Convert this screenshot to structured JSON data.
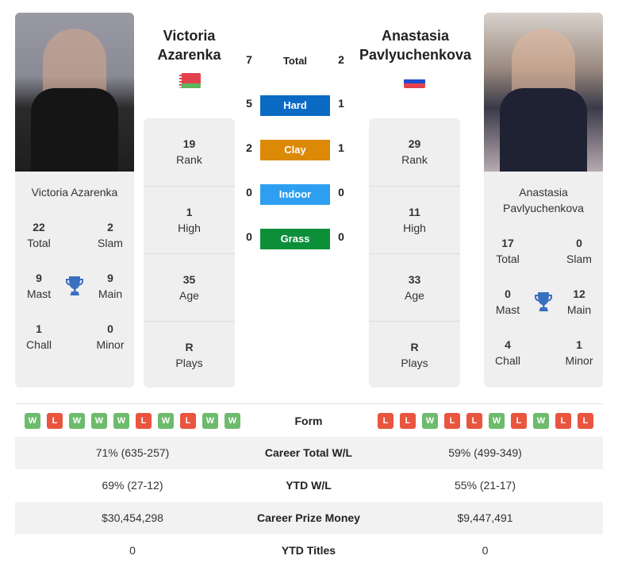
{
  "player1": {
    "name_line1": "Victoria",
    "name_line2": "Azarenka",
    "card_name": "Victoria Azarenka",
    "flag": "Belarus",
    "rank": {
      "value": "19",
      "label": "Rank"
    },
    "high": {
      "value": "1",
      "label": "High"
    },
    "age": {
      "value": "35",
      "label": "Age"
    },
    "plays": {
      "value": "R",
      "label": "Plays"
    },
    "titles": {
      "total": {
        "value": "22",
        "label": "Total"
      },
      "slam": {
        "value": "2",
        "label": "Slam"
      },
      "mast": {
        "value": "9",
        "label": "Mast"
      },
      "main": {
        "value": "9",
        "label": "Main"
      },
      "chall": {
        "value": "1",
        "label": "Chall"
      },
      "minor": {
        "value": "0",
        "label": "Minor"
      }
    },
    "form": [
      "W",
      "L",
      "W",
      "W",
      "W",
      "L",
      "W",
      "L",
      "W",
      "W"
    ],
    "career_wl": "71% (635-257)",
    "ytd_wl": "69% (27-12)",
    "prize_money": "$30,454,298",
    "ytd_titles": "0"
  },
  "player2": {
    "name_line1": "Anastasia",
    "name_line2": "Pavlyuchenkova",
    "card_name_line1": "Anastasia",
    "card_name_line2": "Pavlyuchenkova",
    "flag": "Russia",
    "rank": {
      "value": "29",
      "label": "Rank"
    },
    "high": {
      "value": "11",
      "label": "High"
    },
    "age": {
      "value": "33",
      "label": "Age"
    },
    "plays": {
      "value": "R",
      "label": "Plays"
    },
    "titles": {
      "total": {
        "value": "17",
        "label": "Total"
      },
      "slam": {
        "value": "0",
        "label": "Slam"
      },
      "mast": {
        "value": "0",
        "label": "Mast"
      },
      "main": {
        "value": "12",
        "label": "Main"
      },
      "chall": {
        "value": "4",
        "label": "Chall"
      },
      "minor": {
        "value": "1",
        "label": "Minor"
      }
    },
    "form": [
      "L",
      "L",
      "W",
      "L",
      "L",
      "W",
      "L",
      "W",
      "L",
      "L"
    ],
    "career_wl": "59% (499-349)",
    "ytd_wl": "55% (21-17)",
    "prize_money": "$9,447,491",
    "ytd_titles": "0"
  },
  "h2h": {
    "total": {
      "label": "Total",
      "p1": "7",
      "p2": "2"
    },
    "surfaces": [
      {
        "label": "Hard",
        "p1": "5",
        "p2": "1",
        "color": "#0a6bc4"
      },
      {
        "label": "Clay",
        "p1": "2",
        "p2": "1",
        "color": "#dc8a06"
      },
      {
        "label": "Indoor",
        "p1": "0",
        "p2": "0",
        "color": "#2e9ff0"
      },
      {
        "label": "Grass",
        "p1": "0",
        "p2": "0",
        "color": "#0d8f3a"
      }
    ]
  },
  "comparison": {
    "form_label": "Form",
    "career_wl_label": "Career Total W/L",
    "ytd_wl_label": "YTD W/L",
    "prize_label": "Career Prize Money",
    "ytd_titles_label": "YTD Titles"
  },
  "colors": {
    "win": "#6dbb6d",
    "loss": "#e9553f",
    "trophy": "#3a6fbf"
  }
}
